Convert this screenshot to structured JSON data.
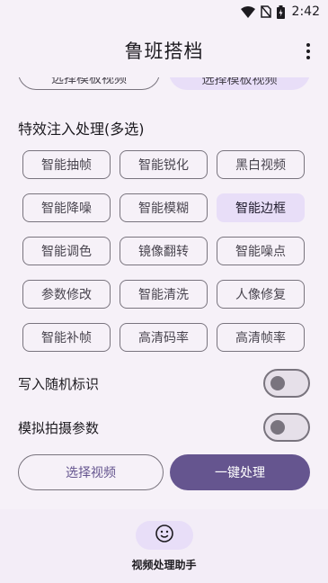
{
  "status_bar": {
    "time": "2:42",
    "icons": [
      "wifi-icon",
      "no-sim-icon",
      "battery-icon"
    ]
  },
  "app_bar": {
    "title": "鲁班搭档",
    "menu_icon": "more-vert-icon"
  },
  "clipped_buttons": {
    "left_label": "选择模板视频",
    "right_label": "选择模板视频"
  },
  "effects": {
    "title": "特效注入处理(多选)",
    "chips": [
      {
        "label": "智能抽帧",
        "selected": false
      },
      {
        "label": "智能锐化",
        "selected": false
      },
      {
        "label": "黑白视频",
        "selected": false
      },
      {
        "label": "智能降噪",
        "selected": false
      },
      {
        "label": "智能模糊",
        "selected": false
      },
      {
        "label": "智能边框",
        "selected": true
      },
      {
        "label": "智能调色",
        "selected": false
      },
      {
        "label": "镜像翻转",
        "selected": false
      },
      {
        "label": "智能噪点",
        "selected": false
      },
      {
        "label": "参数修改",
        "selected": false
      },
      {
        "label": "智能清洗",
        "selected": false
      },
      {
        "label": "人像修复",
        "selected": false
      },
      {
        "label": "智能补帧",
        "selected": false
      },
      {
        "label": "高清码率",
        "selected": false
      },
      {
        "label": "高清帧率",
        "selected": false
      }
    ]
  },
  "toggles": {
    "random_id": {
      "label": "写入随机标识",
      "on": false
    },
    "simulate_shoot": {
      "label": "模拟拍摄参数",
      "on": false
    }
  },
  "actions": {
    "select_video": "选择视频",
    "one_click_process": "一键处理"
  },
  "bottom_nav": {
    "icon": "smiley-face-icon",
    "label": "视频处理助手"
  },
  "colors": {
    "primary": "#65558f",
    "secondary_container": "#e8def8",
    "background": "#f6f1f8",
    "outline": "#79747e"
  }
}
